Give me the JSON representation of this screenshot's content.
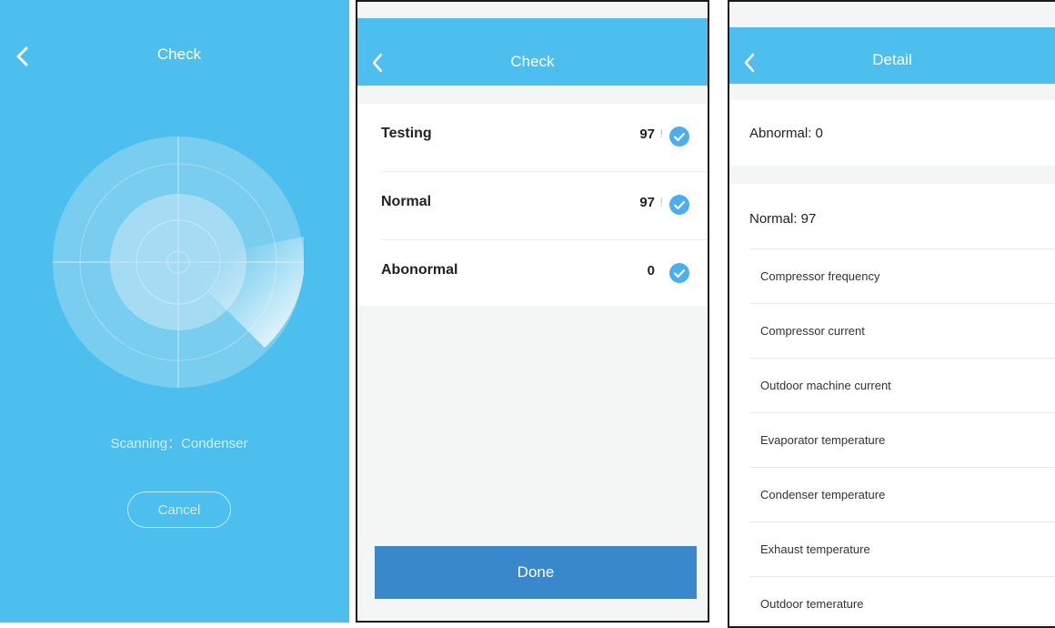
{
  "colors": {
    "header_blue": "#4dbfee",
    "done_blue": "#3a88cc",
    "check_blue": "#4aaef0",
    "page_gray": "#f4f5f5"
  },
  "scan_screen": {
    "title": "Check",
    "back_icon": "chevron-left-icon",
    "status": "Scanning：Condenser",
    "cancel_label": "Cancel"
  },
  "result_screen": {
    "title": "Check",
    "back_icon": "chevron-left-icon",
    "rows": [
      {
        "label": "Testing",
        "count": "97",
        "sep": "!",
        "icon": "check-circle-icon"
      },
      {
        "label": "Normal",
        "count": "97",
        "sep": "!",
        "icon": "check-circle-icon"
      },
      {
        "label": "Abonormal",
        "count": "0",
        "sep": "",
        "icon": "check-circle-icon"
      }
    ],
    "done_label": "Done"
  },
  "detail_screen": {
    "title": "Detail",
    "back_icon": "chevron-left-icon",
    "abnormal_label": "Abnormal: 0",
    "normal_label": "Normal: 97",
    "items": [
      "Compressor frequency",
      "Compressor current",
      "Outdoor machine current",
      "Evaporator temperature",
      "Condenser temperature",
      "Exhaust temperature",
      "Outdoor temerature"
    ]
  }
}
